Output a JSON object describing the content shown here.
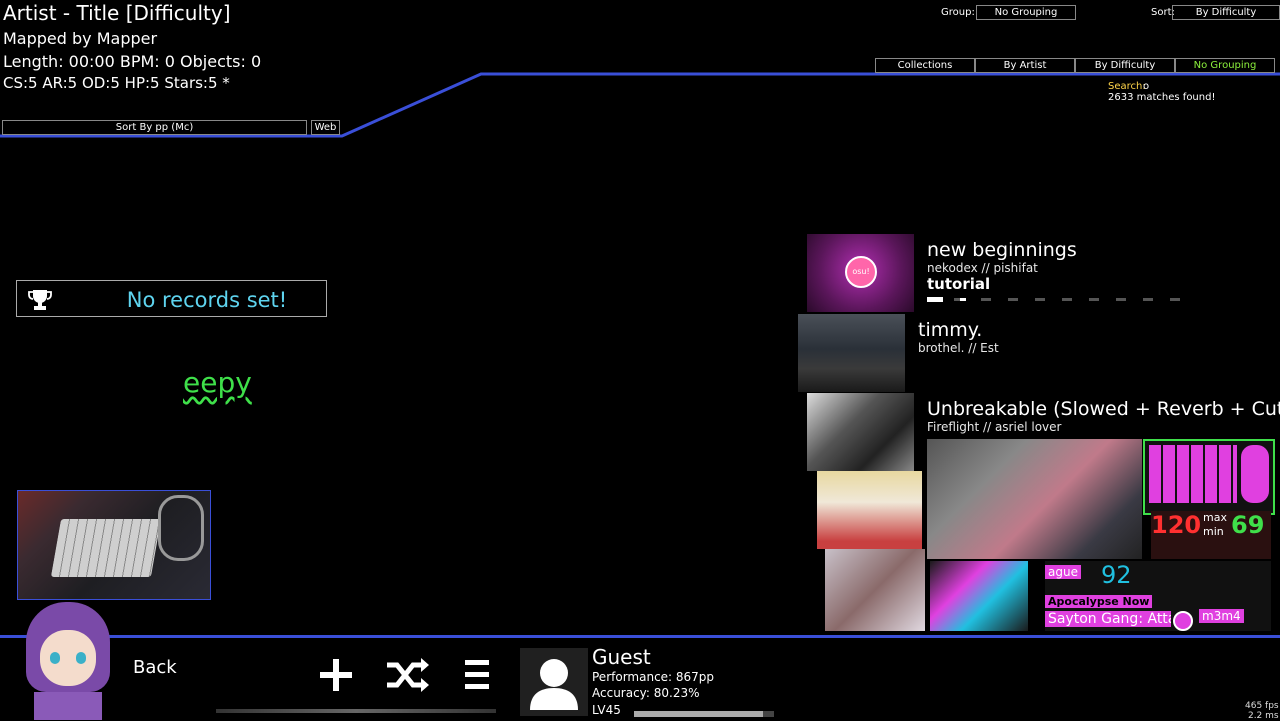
{
  "beatmap": {
    "title": "Artist - Title [Difficulty]",
    "mapper": "Mapped by Mapper",
    "stats_line1": "Length: 00:00 BPM: 0 Objects: 0",
    "stats_line2": "CS:5 AR:5 OD:5 HP:5 Stars:5 *"
  },
  "toolbar": {
    "sort_pp": "Sort By pp (Mc)",
    "web": "Web",
    "group_label": "Group:",
    "group_value": "No Grouping",
    "sort_label": "Sort:",
    "sort_value": "By Difficulty",
    "tabs": [
      "Collections",
      "By Artist",
      "By Difficulty",
      "No Grouping"
    ],
    "active_tab": "No Grouping",
    "search_label": "Search:",
    "search_value": "o",
    "matches": "2633 matches found!",
    "accent_color": "#3a4fd8",
    "active_color": "#8cf03c"
  },
  "records": {
    "text": "No records set!",
    "icon": "trophy-icon"
  },
  "overlay": {
    "eepy": "eepy"
  },
  "songs": [
    {
      "title": "new beginnings",
      "artist": "nekodex // pishifat",
      "difficulty": "tutorial",
      "badge": "osu!"
    },
    {
      "title": "timmy.",
      "artist": "brothel. // Est"
    },
    {
      "title": "Unbreakable (Slowed + Reverb + Cut Ve",
      "artist": "Fireflight // asriel lover"
    }
  ],
  "stream_overlay": {
    "title": "Apocalypse Now",
    "subtitle": "Sayton Gang: Atta",
    "number": "92",
    "corner_text": "m3m4",
    "left_text": "ague",
    "max_value": "120",
    "min_value": "69",
    "max_label": "max",
    "min_label": "min"
  },
  "bottom": {
    "back": "Back",
    "user": "Guest",
    "performance": "Performance: 867pp",
    "accuracy": "Accuracy: 80.23%",
    "level": "LV45",
    "level_progress": 0.92,
    "fps": "465 fps",
    "frametime": "2.2 ms"
  }
}
